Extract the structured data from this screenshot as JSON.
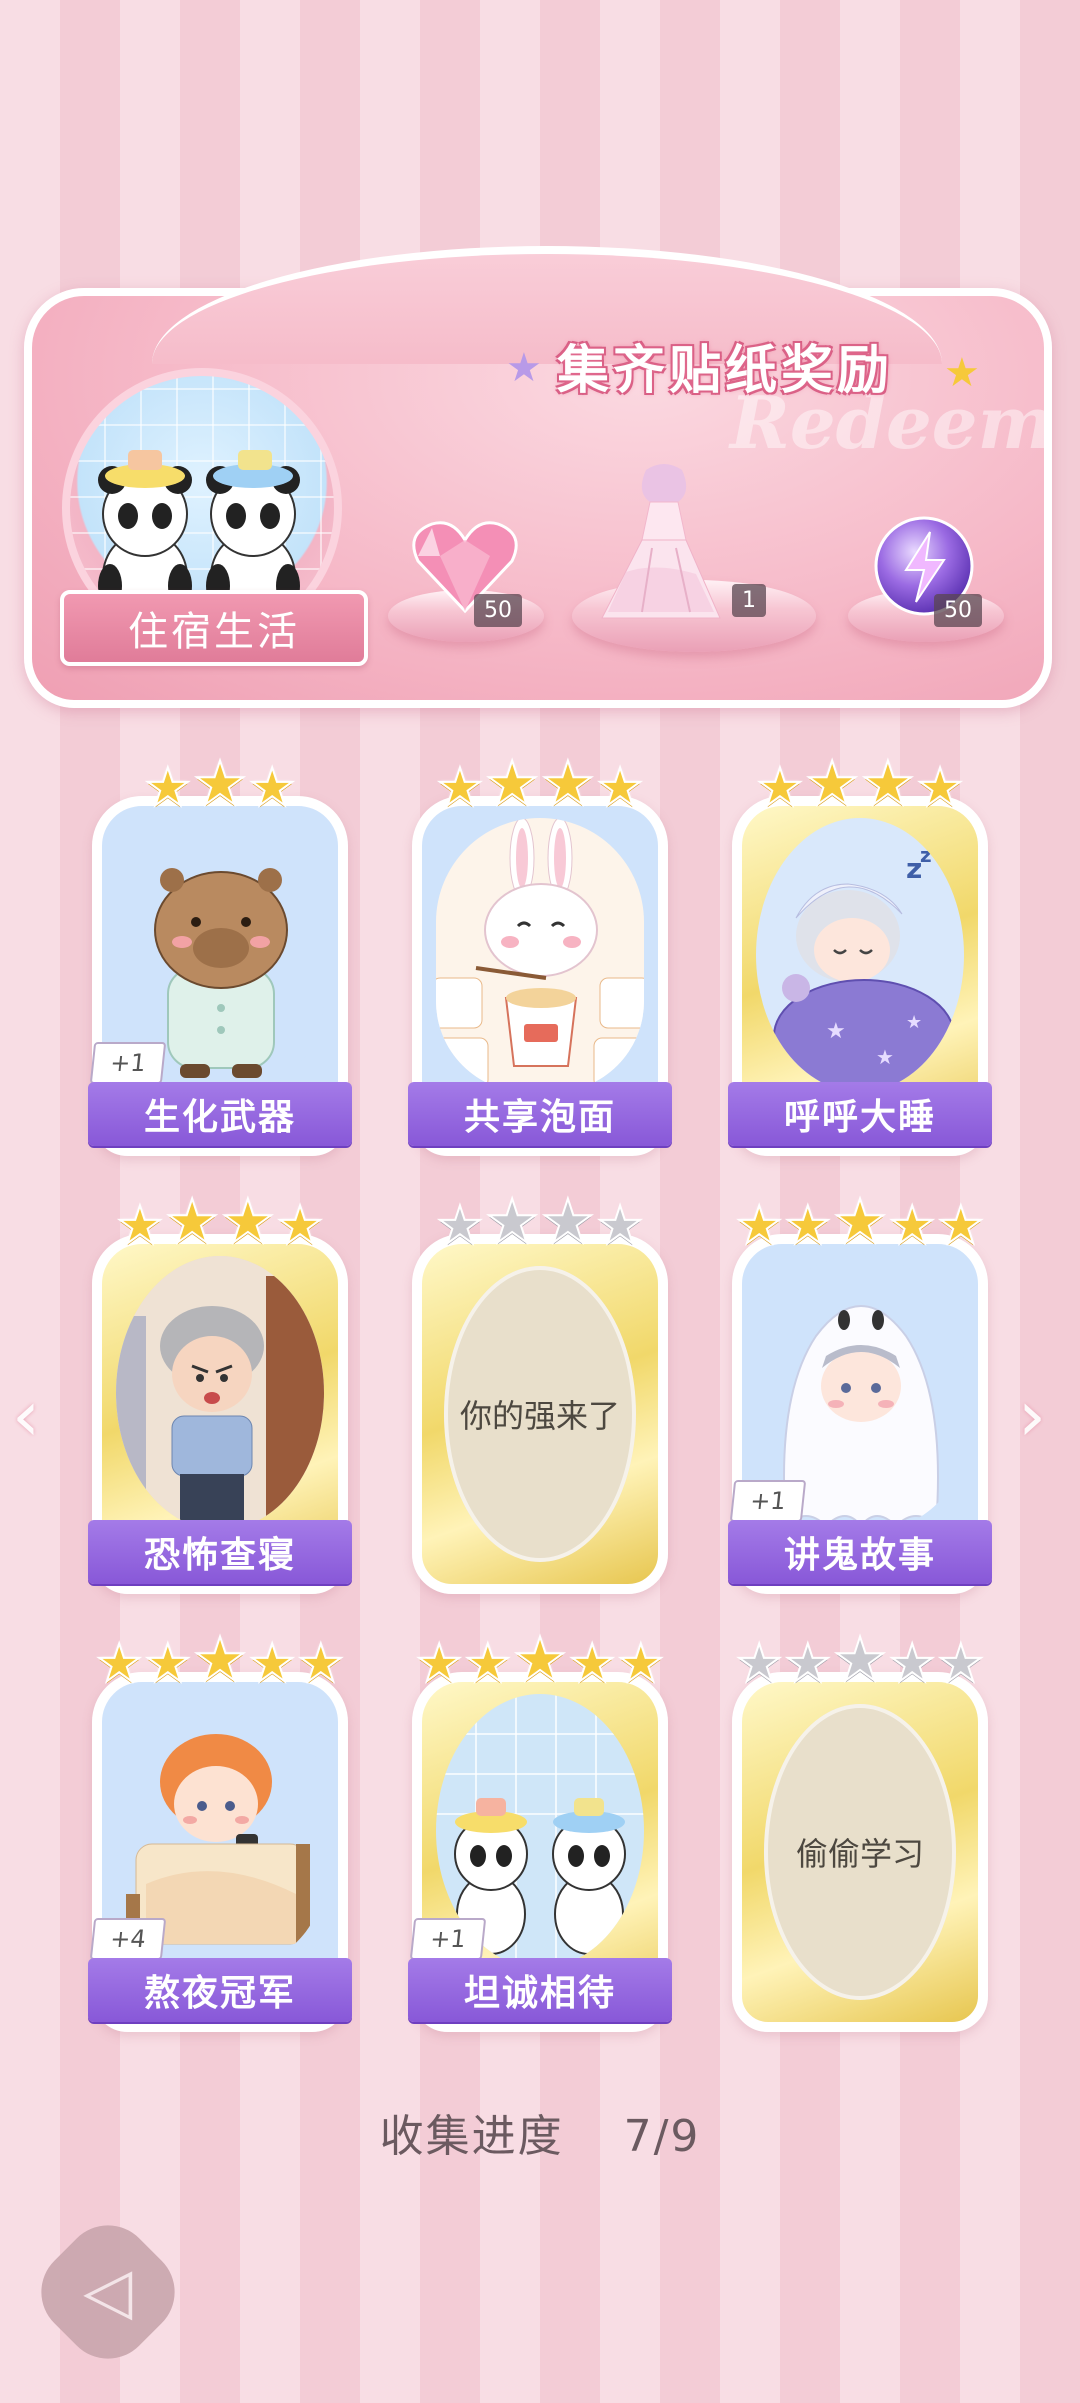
{
  "banner": {
    "title": "集齐贴纸奖励",
    "watermark": "Redeem",
    "album_name": "住宿生活",
    "rewards": [
      {
        "icon": "pink-heart-gem-icon",
        "count": "50"
      },
      {
        "icon": "princess-dress-icon",
        "count": "1"
      },
      {
        "icon": "purple-lightning-orb-icon",
        "count": "50"
      }
    ]
  },
  "stickers": [
    {
      "name": "生化武器",
      "stars": 3,
      "max_stars": 3,
      "rarity": "normal",
      "plus": "+1",
      "collected": true,
      "art": "capybara-in-pajamas"
    },
    {
      "name": "共享泡面",
      "stars": 4,
      "max_stars": 4,
      "rarity": "normal",
      "plus": "",
      "collected": true,
      "art": "bunny-eating-noodles"
    },
    {
      "name": "呼呼大睡",
      "stars": 4,
      "max_stars": 4,
      "rarity": "gold",
      "plus": "",
      "collected": true,
      "art": "boy-sleeping"
    },
    {
      "name": "恐怖查寝",
      "stars": 4,
      "max_stars": 4,
      "rarity": "gold",
      "plus": "",
      "collected": true,
      "art": "dorm-auntie"
    },
    {
      "name": "你的强来了",
      "stars": 0,
      "max_stars": 4,
      "rarity": "gold",
      "plus": "",
      "collected": false,
      "art": ""
    },
    {
      "name": "讲鬼故事",
      "stars": 5,
      "max_stars": 5,
      "rarity": "normal",
      "plus": "+1",
      "collected": true,
      "art": "boy-in-ghost-sheet"
    },
    {
      "name": "熬夜冠军",
      "stars": 5,
      "max_stars": 5,
      "rarity": "normal",
      "plus": "+4",
      "collected": true,
      "art": "boy-on-phone-in-bed"
    },
    {
      "name": "坦诚相待",
      "stars": 5,
      "max_stars": 5,
      "rarity": "gold",
      "plus": "+1",
      "collected": true,
      "art": "pandas-in-bath"
    },
    {
      "name": "偷偷学习",
      "stars": 0,
      "max_stars": 5,
      "rarity": "gold",
      "plus": "",
      "collected": false,
      "art": ""
    }
  ],
  "progress": {
    "label": "收集进度",
    "value": "7/9"
  },
  "nav": {
    "prev_icon": "chevron-left-icon",
    "next_icon": "chevron-right-icon",
    "back_icon": "back-arrow-icon"
  },
  "colors": {
    "label_purple": "#8858d8",
    "star_gold": "#f6c93a",
    "banner_pink": "#f6b9c8"
  }
}
